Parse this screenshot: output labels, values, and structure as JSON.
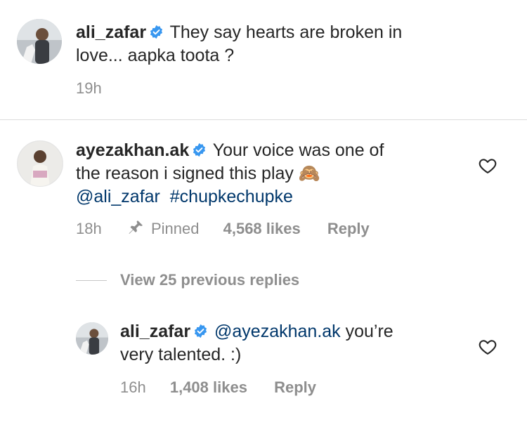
{
  "caption": {
    "username": "ali_zafar",
    "text_line1": "They say hearts are broken in",
    "text_line2": "love... aapka toota ?",
    "time": "19h"
  },
  "comment": {
    "username": "ayezakhan.ak",
    "text_line1": "Your voice was one of",
    "text_line2": "the reason i signed this play",
    "emoji": "🙈",
    "mention": "@ali_zafar",
    "hashtag": "#chupkechupke",
    "time": "18h",
    "pinned_label": "Pinned",
    "likes": "4,568 likes",
    "reply_label": "Reply"
  },
  "view_replies": "View 25 previous replies",
  "reply": {
    "username": "ali_zafar",
    "mention": "@ayezakhan.ak",
    "text_line1_rest": "you’re",
    "text_line2": "very talented. :)",
    "time": "16h",
    "likes": "1,408 likes",
    "reply_label": "Reply"
  },
  "colors": {
    "verified": "#3897f0",
    "link": "#00376b",
    "muted": "#8e8e8e",
    "text": "#262626"
  },
  "icons": [
    "verified-badge-icon",
    "heart-icon",
    "pin-icon"
  ]
}
